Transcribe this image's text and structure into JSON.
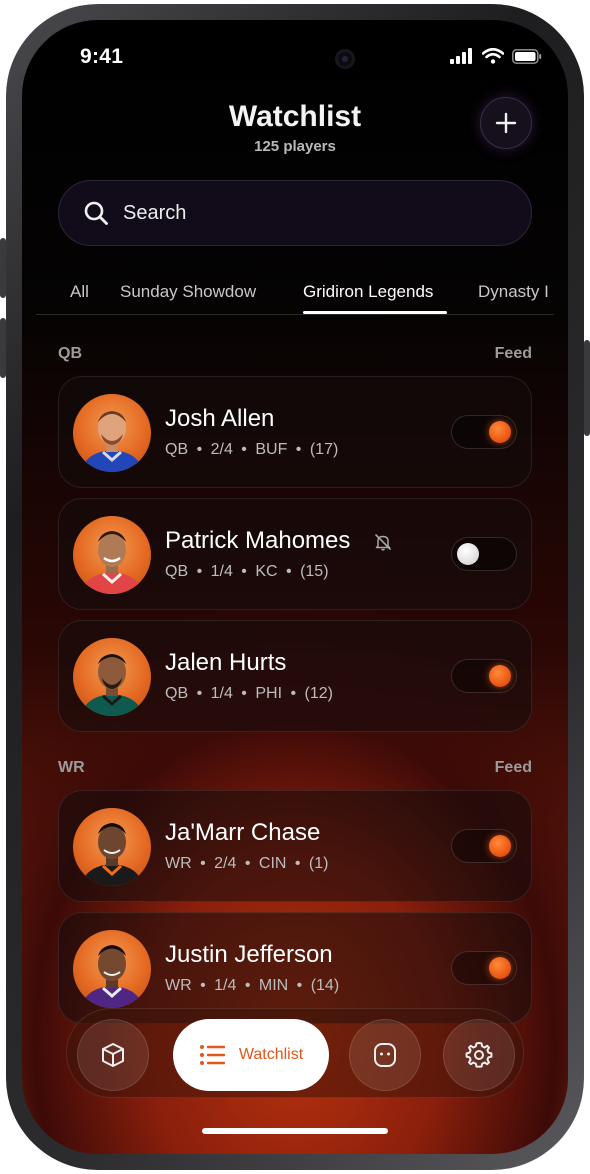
{
  "status_bar": {
    "time": "9:41"
  },
  "header": {
    "title": "Watchlist",
    "subtitle": "125 players"
  },
  "search": {
    "placeholder": "Search"
  },
  "tabs": [
    {
      "label": "All",
      "active": false
    },
    {
      "label": "Sunday Showdow",
      "active": false
    },
    {
      "label": "Gridiron Legends",
      "active": true
    },
    {
      "label": "Dynasty I",
      "active": false
    }
  ],
  "sections": [
    {
      "label": "QB",
      "feed_label": "Feed",
      "players": [
        {
          "name": "Josh Allen",
          "meta": "QB • 2/4 • BUF • (17)",
          "feed_on": true,
          "muted": false
        },
        {
          "name": "Patrick Mahomes",
          "meta": "QB • 1/4 • KC • (15)",
          "feed_on": false,
          "muted": true
        },
        {
          "name": "Jalen Hurts",
          "meta": "QB • 1/4 • PHI • (12)",
          "feed_on": true,
          "muted": false
        }
      ]
    },
    {
      "label": "WR",
      "feed_label": "Feed",
      "players": [
        {
          "name": "Ja'Marr Chase",
          "meta": "WR • 2/4 • CIN • (1)",
          "feed_on": true,
          "muted": false
        },
        {
          "name": "Justin Jefferson",
          "meta": "WR • 1/4 • MIN • (14)",
          "feed_on": true,
          "muted": false
        }
      ]
    }
  ],
  "bottom_nav": {
    "items": [
      {
        "icon": "cube-icon",
        "label": ""
      },
      {
        "icon": "list-icon",
        "label": "Watchlist",
        "active": true
      },
      {
        "icon": "face-icon",
        "label": ""
      },
      {
        "icon": "gear-icon",
        "label": ""
      }
    ]
  },
  "colors": {
    "accent": "#EC5A14",
    "background_glow": "#B8320E",
    "active_nav_bg": "#FFFFFF"
  }
}
